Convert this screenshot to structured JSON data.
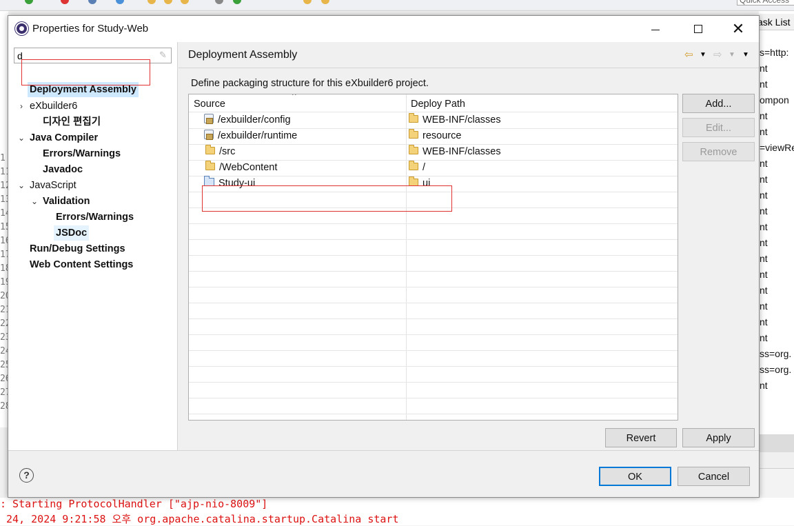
{
  "ide": {
    "quick_access": "Quick Access",
    "task_tab": "Task List",
    "right_lines": [
      "s=http:",
      "nt",
      "nt",
      "ompon",
      "nt",
      "nt",
      "=viewRe",
      "nt",
      "nt",
      "nt",
      "nt",
      "nt",
      "nt",
      "nt",
      "nt",
      "nt",
      "nt",
      "nt",
      "nt",
      "ss=org.",
      "ss=org.",
      "nt"
    ],
    "left_lines": [
      "1",
      "11",
      "12",
      "13",
      "14",
      "15",
      "16",
      "17",
      "18",
      "19",
      "20",
      "21",
      "22",
      "23",
      "24",
      "25",
      "26",
      "27",
      "28"
    ],
    "console": {
      "line1": ": Starting ProtocolHandler [\"ajp-nio-8009\"]",
      "line2": " 24, 2024 9:21:58 오후 org.apache.catalina.startup.Catalina start"
    }
  },
  "dialog": {
    "title": "Properties for Study-Web",
    "filter_value": "d",
    "tree": {
      "deployment_assembly": "Deployment Assembly",
      "exbuilder6": "eXbuilder6",
      "design_editor": "디자인 편집기",
      "java_compiler": "Java Compiler",
      "errors_warnings": "Errors/Warnings",
      "javadoc": "Javadoc",
      "javascript": "JavaScript",
      "validation": "Validation",
      "js_errors_warnings": "Errors/Warnings",
      "jsdoc": "JSDoc",
      "run_debug": "Run/Debug Settings",
      "web_content": "Web Content Settings"
    },
    "page": {
      "title": "Deployment Assembly",
      "description": "Define packaging structure for this eXbuilder6 project.",
      "columns": {
        "source": "Source",
        "deploy_path": "Deploy Path"
      },
      "rows": [
        {
          "source": "/exbuilder/config",
          "source_icon": "library-icon",
          "deploy": "WEB-INF/classes"
        },
        {
          "source": "/exbuilder/runtime",
          "source_icon": "library-icon",
          "deploy": "resource"
        },
        {
          "source": "/src",
          "source_icon": "folder-icon",
          "deploy": "WEB-INF/classes"
        },
        {
          "source": "/WebContent",
          "source_icon": "folder-icon",
          "deploy": "/"
        },
        {
          "source": "Study-ui",
          "source_icon": "project-icon",
          "deploy": "ui"
        }
      ],
      "buttons": {
        "add": "Add...",
        "edit": "Edit...",
        "remove": "Remove"
      }
    },
    "apply_bar": {
      "revert": "Revert",
      "apply": "Apply"
    },
    "footer": {
      "ok": "OK",
      "cancel": "Cancel",
      "help": "?"
    },
    "colors": {
      "selection": "#cde8ff",
      "highlight_box": "#e03030",
      "default_button_border": "#0078d7"
    }
  }
}
